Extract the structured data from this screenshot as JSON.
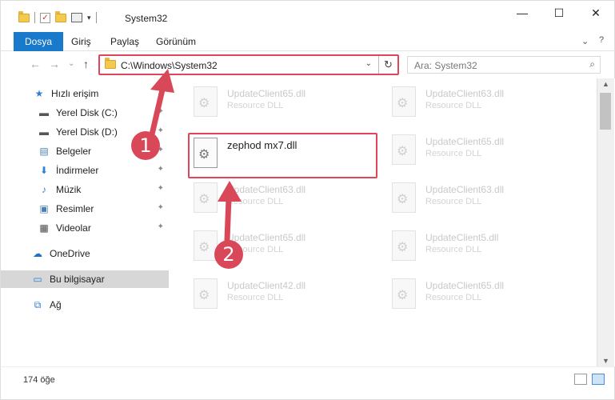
{
  "window": {
    "title": "System32",
    "minimize": "—",
    "maximize": "☐",
    "close": "✕"
  },
  "ribbon": {
    "tabs": [
      "Dosya",
      "Giriş",
      "Paylaş",
      "Görünüm"
    ],
    "collapse": "⌄",
    "help": "?"
  },
  "nav": {
    "back": "←",
    "forward": "→",
    "recent": "⌄",
    "up": "↑",
    "address_path": "C:\\Windows\\System32",
    "address_dropdown": "⌄",
    "refresh": "↻",
    "search_placeholder": "Ara: System32",
    "search_icon": "⌕"
  },
  "sidebar": {
    "items": [
      {
        "label": "Hızlı erişim",
        "icon": "star-icon",
        "pinned": false
      },
      {
        "label": "Yerel Disk (C:)",
        "icon": "drive-icon",
        "pinned": true
      },
      {
        "label": "Yerel Disk (D:)",
        "icon": "drive-icon",
        "pinned": true
      },
      {
        "label": "Belgeler",
        "icon": "documents-icon",
        "pinned": true
      },
      {
        "label": "İndirmeler",
        "icon": "download-icon",
        "pinned": true
      },
      {
        "label": "Müzik",
        "icon": "music-icon",
        "pinned": true
      },
      {
        "label": "Resimler",
        "icon": "pictures-icon",
        "pinned": true
      },
      {
        "label": "Videolar",
        "icon": "videos-icon",
        "pinned": true
      },
      {
        "label": "OneDrive",
        "icon": "cloud-icon",
        "pinned": false
      },
      {
        "label": "Bu bilgisayar",
        "icon": "computer-icon",
        "pinned": false,
        "selected": true
      },
      {
        "label": "Ağ",
        "icon": "network-icon",
        "pinned": false
      }
    ],
    "pin_glyph": "📌"
  },
  "files": {
    "highlighted": {
      "name": "zephod mx7.dll"
    },
    "left_column": [
      {
        "name": "UpdateClient65.dll",
        "type": "Resource DLL"
      },
      {
        "name": "UpdateClient63.dll",
        "type": "Resource DLL"
      },
      {
        "name": "UpdateClient65.dll",
        "type": "Resource DLL"
      },
      {
        "name": "UpdateClient42.dll",
        "type": "Resource DLL"
      }
    ],
    "right_column": [
      {
        "name": "UpdateClient63.dll",
        "type": "Resource DLL"
      },
      {
        "name": "UpdateClient65.dll",
        "type": "Resource DLL"
      },
      {
        "name": "UpdateClient63.dll",
        "type": "Resource DLL"
      },
      {
        "name": "UpdateClient5.dll",
        "type": "Resource DLL"
      },
      {
        "name": "UpdateClient65.dll",
        "type": "Resource DLL"
      }
    ]
  },
  "annotations": {
    "step1": "1",
    "step2": "2",
    "highlight_color": "#e0455a"
  },
  "status": {
    "item_count": "174 öğe"
  },
  "colors": {
    "accent": "#1979ca",
    "annotation": "#e0455a"
  }
}
